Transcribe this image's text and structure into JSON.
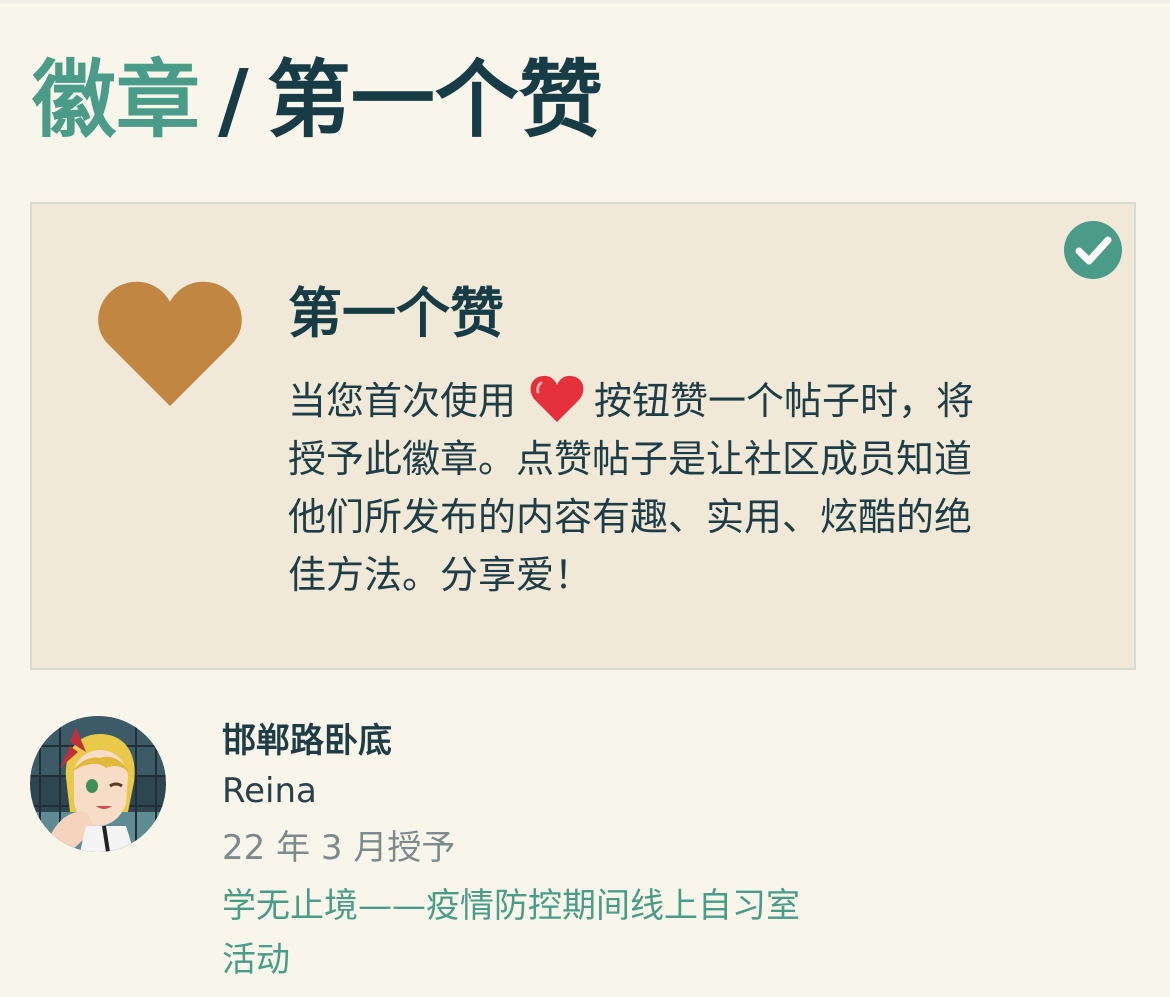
{
  "breadcrumb": {
    "parent": "徽章",
    "separator": "/",
    "current": "第一个赞"
  },
  "badge": {
    "name": "第一个赞",
    "icon": "heart-icon",
    "icon_color": "#c08642",
    "granted_icon": "check-circle-icon",
    "granted_color": "#4a9c88",
    "description_lines": [
      "当您首次使用",
      "按钮赞一个帖子时，将",
      "授予此徽章。点赞帖子是让社区成员知道",
      "他们所发布的内容有趣、实用、炫酷的绝",
      "佳方法。分享爱！"
    ],
    "inline_icon": "red-heart-emoji"
  },
  "grant": {
    "user_name": "邯郸路卧底",
    "user_handle": "Reina",
    "date": "22 年 3 月授予",
    "topic_lines": [
      "学无止境——疫情防控期间线上自习室",
      "活动"
    ]
  },
  "colors": {
    "background": "#f8f6eb",
    "card_background": "#f0e9d8",
    "accent": "#4a9c88",
    "heading": "#183c45"
  }
}
